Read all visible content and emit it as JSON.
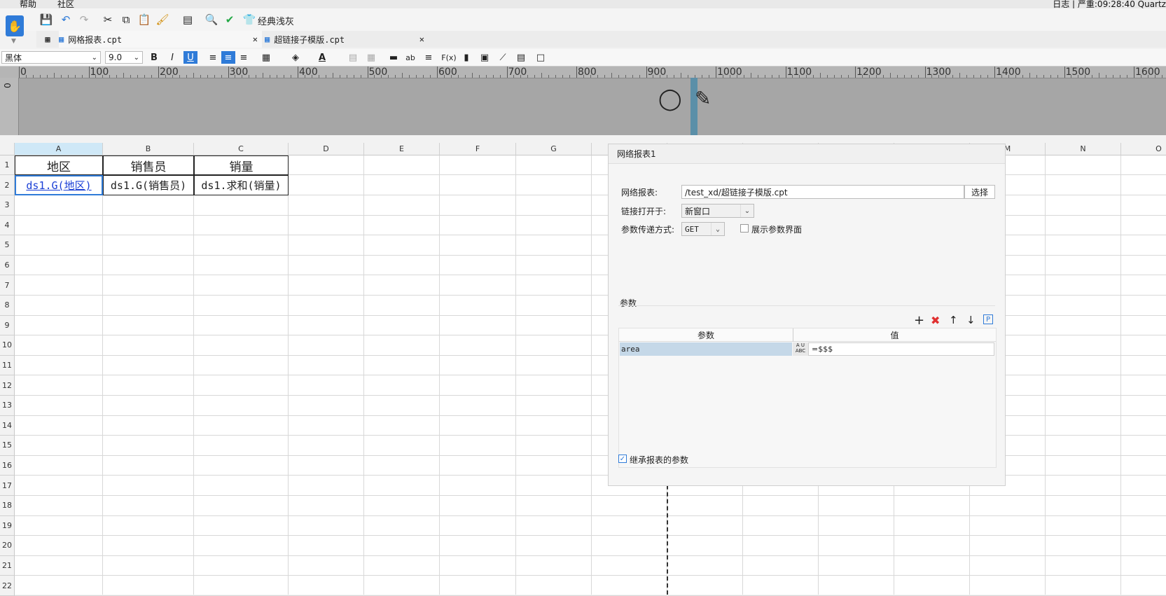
{
  "menubar": {
    "help": "帮助",
    "community": "社区",
    "status_right": "日志 | 严重:09:28:40 Quartz"
  },
  "toolbar": {
    "theme_label": "经典浅灰"
  },
  "tabs": [
    {
      "label": "网格报表.cpt"
    },
    {
      "label": "超链接子模版.cpt"
    }
  ],
  "format": {
    "font": "黑体",
    "size": "9.0",
    "bold": "B",
    "italic": "I",
    "underline": "U",
    "ab": "ab",
    "fx": "F(x)"
  },
  "ruler": {
    "ticks": [
      "0",
      "100",
      "200",
      "300",
      "400",
      "500",
      "600",
      "700",
      "800",
      "900",
      "1000",
      "1100",
      "1200",
      "1300",
      "1400",
      "1500",
      "1600"
    ],
    "left_zero": "0"
  },
  "grid": {
    "columns": [
      "A",
      "B",
      "C",
      "D",
      "E",
      "F",
      "G",
      "",
      "",
      "",
      "",
      "",
      "M",
      "N",
      "O"
    ],
    "rows": [
      "1",
      "2",
      "3",
      "4",
      "5",
      "6",
      "7",
      "8",
      "9",
      "10",
      "11",
      "12",
      "13",
      "14",
      "15",
      "16",
      "17",
      "18",
      "19",
      "20",
      "21",
      "22"
    ],
    "cells": {
      "a1": "地区",
      "b1": "销售员",
      "c1": "销量",
      "a2": "ds1.G(地区)",
      "b2": "ds1.G(销售员)",
      "c2": "ds1.求和(销量)"
    }
  },
  "dialog": {
    "title": "网络报表1",
    "report_label": "网络报表:",
    "report_value": "/test_xd/超链接子模版.cpt",
    "choose_button": "选择",
    "open_in_label": "链接打开于:",
    "open_in_value": "新窗口",
    "method_label": "参数传递方式:",
    "method_value": "GET",
    "show_params_label": "展示参数界面",
    "show_params_checked": false,
    "params_section": "参数",
    "params_table": {
      "headers": [
        "参数",
        "值"
      ],
      "rows": [
        {
          "name": "area",
          "value": "=$$$"
        }
      ]
    },
    "inherit_label": "继承报表的参数",
    "inherit_checked": true
  },
  "colors": {
    "accent": "#2f7bd8",
    "link": "#1a3fd6",
    "selected_header": "#cfe8f7",
    "param_row": "#c5d8e8",
    "delete": "#e03030",
    "check_green": "#22a845"
  }
}
